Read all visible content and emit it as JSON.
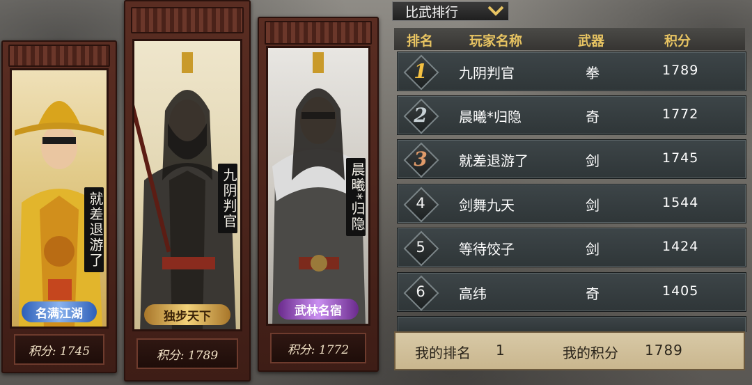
{
  "tab": {
    "label": "比武排行",
    "icon": "chevron-down-icon"
  },
  "header": {
    "rank": "排名",
    "player": "玩家名称",
    "weapon": "武器",
    "score": "积分"
  },
  "rows": [
    {
      "rank": "1",
      "name": "九阴判官",
      "weapon": "拳",
      "score": "1789"
    },
    {
      "rank": "2",
      "name": "晨曦*归隐",
      "weapon": "奇",
      "score": "1772"
    },
    {
      "rank": "3",
      "name": "就差退游了",
      "weapon": "剑",
      "score": "1745"
    },
    {
      "rank": "4",
      "name": "剑舞九天",
      "weapon": "剑",
      "score": "1544"
    },
    {
      "rank": "5",
      "name": "等待饺子",
      "weapon": "剑",
      "score": "1424"
    },
    {
      "rank": "6",
      "name": "高纬",
      "weapon": "奇",
      "score": "1405"
    }
  ],
  "my": {
    "rank_label": "我的排名",
    "rank_value": "1",
    "score_label": "我的积分",
    "score_value": "1789"
  },
  "podium": [
    {
      "name": "就差退游了",
      "title": "名满江湖",
      "score_text": "积分: 1745",
      "panel": "gold"
    },
    {
      "name": "九阴判官",
      "title": "独步天下",
      "score_text": "积分: 1789",
      "panel": "cream"
    },
    {
      "name": "晨曦*归隐",
      "title": "武林名宿",
      "score_text": "积分: 1772",
      "panel": "silver"
    }
  ],
  "colors": {
    "header_text": "#e8c462",
    "rank1": "#f5c142",
    "rank2": "#c7d0d4",
    "rank3": "#e09b6a",
    "frame": "#5a2d22"
  }
}
